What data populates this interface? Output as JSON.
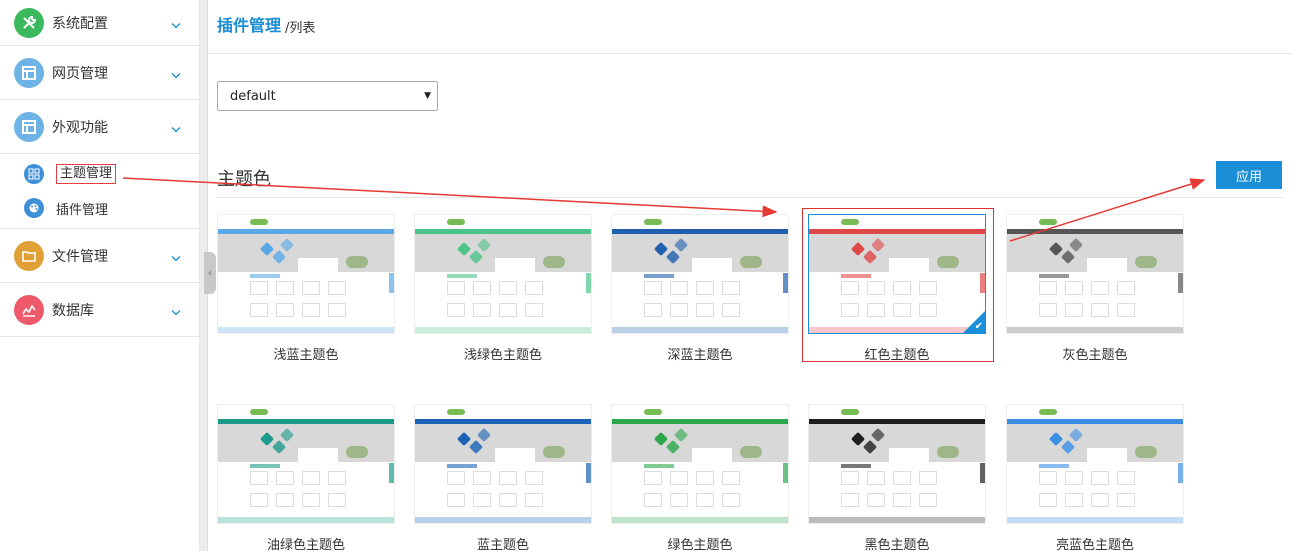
{
  "sidebar": {
    "items": [
      {
        "label": "系统配置",
        "icon": "wrench-icon",
        "color": "#3cb95f"
      },
      {
        "label": "网页管理",
        "icon": "layout-icon",
        "color": "#6db3e6"
      },
      {
        "label": "外观功能",
        "icon": "layout-icon",
        "color": "#6db3e6"
      },
      {
        "label": "文件管理",
        "icon": "folder-icon",
        "color": "#e0a035"
      },
      {
        "label": "数据库",
        "icon": "chart-icon",
        "color": "#ef5a6b"
      }
    ],
    "subitems": [
      {
        "label": "主题管理",
        "icon": "grid-icon",
        "color": "#3e8fd6",
        "active": true
      },
      {
        "label": "插件管理",
        "icon": "palette-icon",
        "color": "#3e8fd6",
        "active": false
      }
    ]
  },
  "header": {
    "title": "插件管理",
    "crumb": "/列表"
  },
  "select": {
    "value": "default"
  },
  "section": {
    "title": "主题色",
    "apply_label": "应用"
  },
  "themes": [
    {
      "label": "浅蓝主题色",
      "accent": "#5aa9e6",
      "selected": false
    },
    {
      "label": "浅绿色主题色",
      "accent": "#4cc48a",
      "selected": false
    },
    {
      "label": "深蓝主题色",
      "accent": "#1f5fae",
      "selected": false
    },
    {
      "label": "红色主题色",
      "accent": "#e04848",
      "selected": true
    },
    {
      "label": "灰色主题色",
      "accent": "#555555",
      "selected": false
    },
    {
      "label": "油绿色主题色",
      "accent": "#1e9a8a",
      "selected": false
    },
    {
      "label": "蓝主题色",
      "accent": "#1a63b8",
      "selected": false
    },
    {
      "label": "绿色主题色",
      "accent": "#2aa84a",
      "selected": false
    },
    {
      "label": "黑色主题色",
      "accent": "#1e1e1e",
      "selected": false
    },
    {
      "label": "亮蓝色主题色",
      "accent": "#3a8ee6",
      "selected": false
    }
  ]
}
